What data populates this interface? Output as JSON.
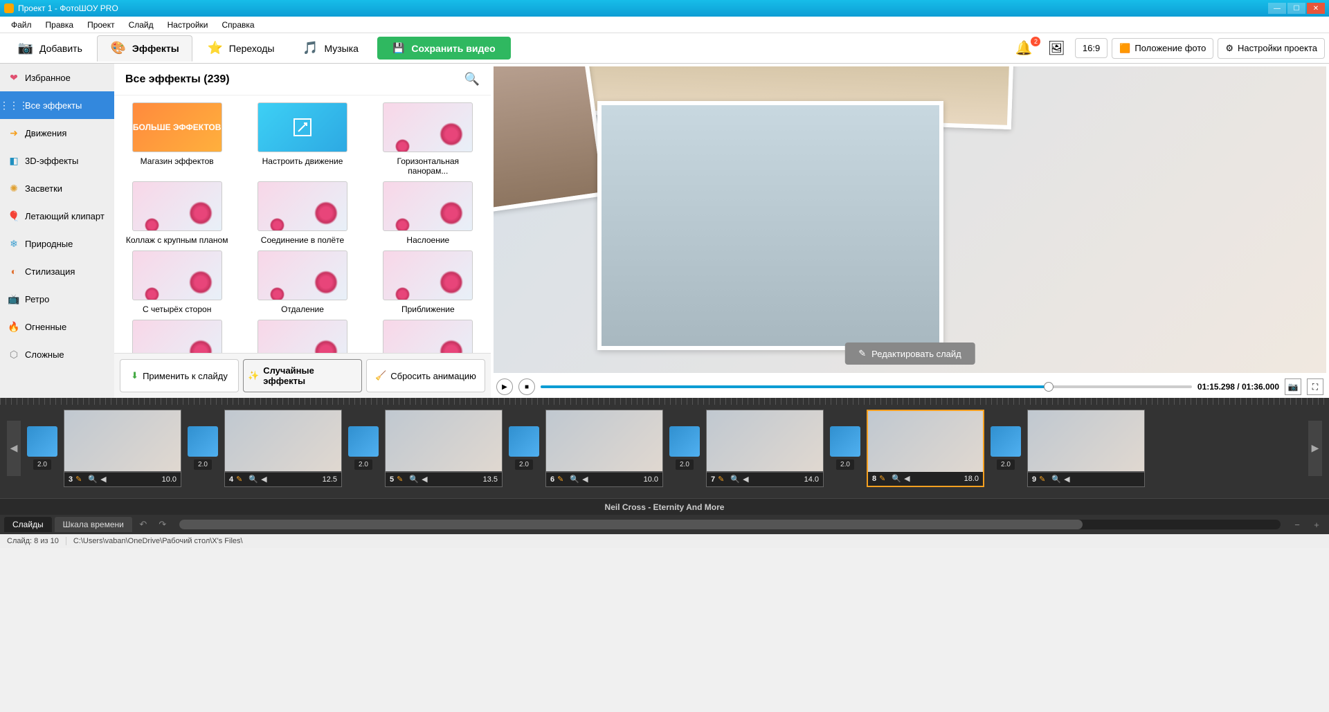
{
  "title": "Проект 1 - ФотоШОУ PRO",
  "menu": [
    "Файл",
    "Правка",
    "Проект",
    "Слайд",
    "Настройки",
    "Справка"
  ],
  "tabs": {
    "add": "Добавить",
    "effects": "Эффекты",
    "transitions": "Переходы",
    "music": "Музыка"
  },
  "save_btn": "Сохранить видео",
  "notif_count": "2",
  "aspect": "16:9",
  "photo_pos": "Положение фото",
  "proj_settings": "Настройки проекта",
  "sidebar": [
    {
      "icon": "❤",
      "label": "Избранное",
      "color": "#e05070"
    },
    {
      "icon": "⋮⋮⋮",
      "label": "Все эффекты",
      "color": "#3388dd"
    },
    {
      "icon": "➜",
      "label": "Движения",
      "color": "#f5a020"
    },
    {
      "icon": "◧",
      "label": "3D-эффекты",
      "color": "#2090c0"
    },
    {
      "icon": "✺",
      "label": "Засветки",
      "color": "#e0a030"
    },
    {
      "icon": "🎈",
      "label": "Летающий клипарт",
      "color": "#d04080"
    },
    {
      "icon": "❄",
      "label": "Природные",
      "color": "#40a0d0"
    },
    {
      "icon": "◐",
      "label": "Стилизация",
      "color": "#e07030"
    },
    {
      "icon": "📺",
      "label": "Ретро",
      "color": "#b05050"
    },
    {
      "icon": "🔥",
      "label": "Огненные",
      "color": "#e05030"
    },
    {
      "icon": "⬡",
      "label": "Сложные",
      "color": "#888"
    }
  ],
  "effects_title": "Все эффекты (239)",
  "effects": [
    {
      "label": "Магазин эффектов",
      "kind": "more",
      "txt": "БОЛЬШЕ ЭФФЕКТОВ"
    },
    {
      "label": "Настроить движение",
      "kind": "config"
    },
    {
      "label": "Горизонтальная панорам..."
    },
    {
      "label": "Коллаж с крупным планом"
    },
    {
      "label": "Соединение в полёте"
    },
    {
      "label": "Наслоение"
    },
    {
      "label": "С четырёх сторон"
    },
    {
      "label": "Отдаление"
    },
    {
      "label": "Приближение"
    },
    {
      "label": ""
    },
    {
      "label": ""
    },
    {
      "label": ""
    }
  ],
  "footer_btns": {
    "apply": "Применить к слайду",
    "random": "Случайные эффекты",
    "reset": "Сбросить анимацию"
  },
  "edit_slide": "Редактировать слайд",
  "time": "01:15.298 / 01:36.000",
  "track": "Neil Cross - Eternity And More",
  "slides": [
    {
      "n": "3",
      "d": "10.0"
    },
    {
      "n": "4",
      "d": "12.5"
    },
    {
      "n": "5",
      "d": "13.5"
    },
    {
      "n": "6",
      "d": "10.0"
    },
    {
      "n": "7",
      "d": "14.0"
    },
    {
      "n": "8",
      "d": "18.0",
      "sel": true
    },
    {
      "n": "9",
      "d": ""
    }
  ],
  "trans_dur": "2.0",
  "btabs": {
    "slides": "Слайды",
    "timeline": "Шкала времени"
  },
  "status": {
    "slide": "Слайд: 8 из 10",
    "path": "C:\\Users\\vaban\\OneDrive\\Рабочий стол\\X's Files\\"
  }
}
